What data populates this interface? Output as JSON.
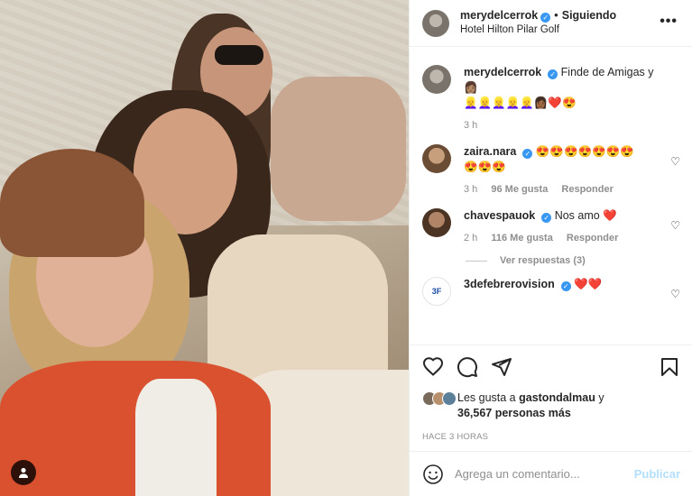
{
  "post": {
    "author": "merydelcerrok",
    "follow_status": "Siguiendo",
    "location": "Hotel Hilton Pilar Golf",
    "more_icon": "ellipsis-icon"
  },
  "caption": {
    "username": "merydelcerrok",
    "text": "Finde de Amigas y 👩🏽",
    "text2": "👱‍♀️👱‍♀️👱‍♀️👱‍♀️👱‍♀️👩🏾❤️😍",
    "time": "3 h"
  },
  "comments": [
    {
      "username": "zaira.nara",
      "text": "😍😍😍😍😍😍😍",
      "text2": "😍😍😍",
      "time": "3 h",
      "likes": "96 Me gusta",
      "reply": "Responder"
    },
    {
      "username": "chavespauok",
      "text": "Nos amo ❤️",
      "time": "2 h",
      "likes": "116 Me gusta",
      "reply": "Responder",
      "view_replies": "Ver respuestas (3)"
    },
    {
      "username": "3defebrerovision",
      "text": "❤️❤️",
      "avatar_text": "3F"
    }
  ],
  "likes": {
    "prefix": "Les gusta a ",
    "user": "gastondalmau",
    "joiner": " y",
    "count": "36,567 personas más"
  },
  "timestamp": "HACE 3 HORAS",
  "composer": {
    "placeholder": "Agrega un comentario...",
    "publish": "Publicar"
  },
  "colors": {
    "verified": "#3897f0",
    "publish_disabled": "#b2dffc",
    "secondary_text": "#8e8e8e"
  }
}
